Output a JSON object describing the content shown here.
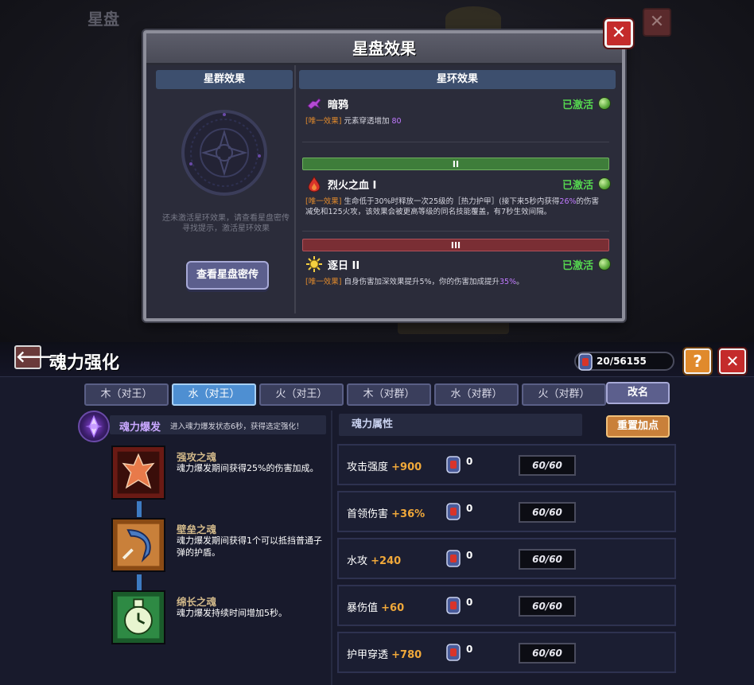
{
  "star_disk": {
    "bg_title": "星盘",
    "popup_title": "星盘效果",
    "close_label": "✕",
    "left_header": "星群效果",
    "left_hint": "还未激活星环效果，请查看星盘密传寻找提示，激活星环效果",
    "view_secret_button": "查看星盘密传",
    "right_header": "星环效果",
    "effects": [
      {
        "name": "暗鸦",
        "status": "已激活",
        "tag": "[唯一效果]",
        "desc_a": " 元素穿透增加 ",
        "value": "80",
        "desc_b": ""
      },
      {
        "tier": "II",
        "name": "烈火之血 I",
        "status": "已激活",
        "tag": "[唯一效果]",
        "desc_a": " 生命低于30%时释放一次25级的［热力护甲］(接下来5秒内获得",
        "value": "26%",
        "desc_b": "的伤害减免和125火攻，该效果会被更高等级的同名技能覆盖，有7秒生效间隔。"
      },
      {
        "tier": "III",
        "name": "逐日 II",
        "status": "已激活",
        "tag": "[唯一效果]",
        "desc_a": " 自身伤害加深效果提升5%，你的伤害加成提升",
        "value": "35%",
        "desc_b": "。"
      }
    ]
  },
  "soul": {
    "title": "魂力强化",
    "back_label": "🡐",
    "currency": "20/56155",
    "help_label": "?",
    "close_label": "✕",
    "tabs": [
      "木（对王）",
      "水（对王）",
      "火（对王）",
      "木（对群）",
      "水（对群）",
      "火（对群）"
    ],
    "active_tab": 1,
    "rename_button": "改名",
    "burst_title": "魂力爆发",
    "burst_desc": "进入魂力爆发状态6秒，获得选定强化！",
    "souls": [
      {
        "name": "强攻之魂",
        "desc": "魂力爆发期间获得25%的伤害加成。"
      },
      {
        "name": "壁垒之魂",
        "desc": "魂力爆发期间获得1个可以抵挡普通子弹的护盾。"
      },
      {
        "name": "绵长之魂",
        "desc": "魂力爆发持续时间增加5秒。"
      }
    ],
    "attr_header": "魂力属性",
    "reset_button": "重置加点",
    "attributes": [
      {
        "label": "攻击强度 ",
        "bonus": "+900",
        "cost": "0",
        "progress": "60/60"
      },
      {
        "label": "首领伤害 ",
        "bonus": "+36%",
        "cost": "0",
        "progress": "60/60"
      },
      {
        "label": "水攻 ",
        "bonus": "+240",
        "cost": "0",
        "progress": "60/60"
      },
      {
        "label": "暴伤值 ",
        "bonus": "+60",
        "cost": "0",
        "progress": "60/60"
      },
      {
        "label": "护甲穿透 ",
        "bonus": "+780",
        "cost": "0",
        "progress": "60/60"
      }
    ]
  }
}
